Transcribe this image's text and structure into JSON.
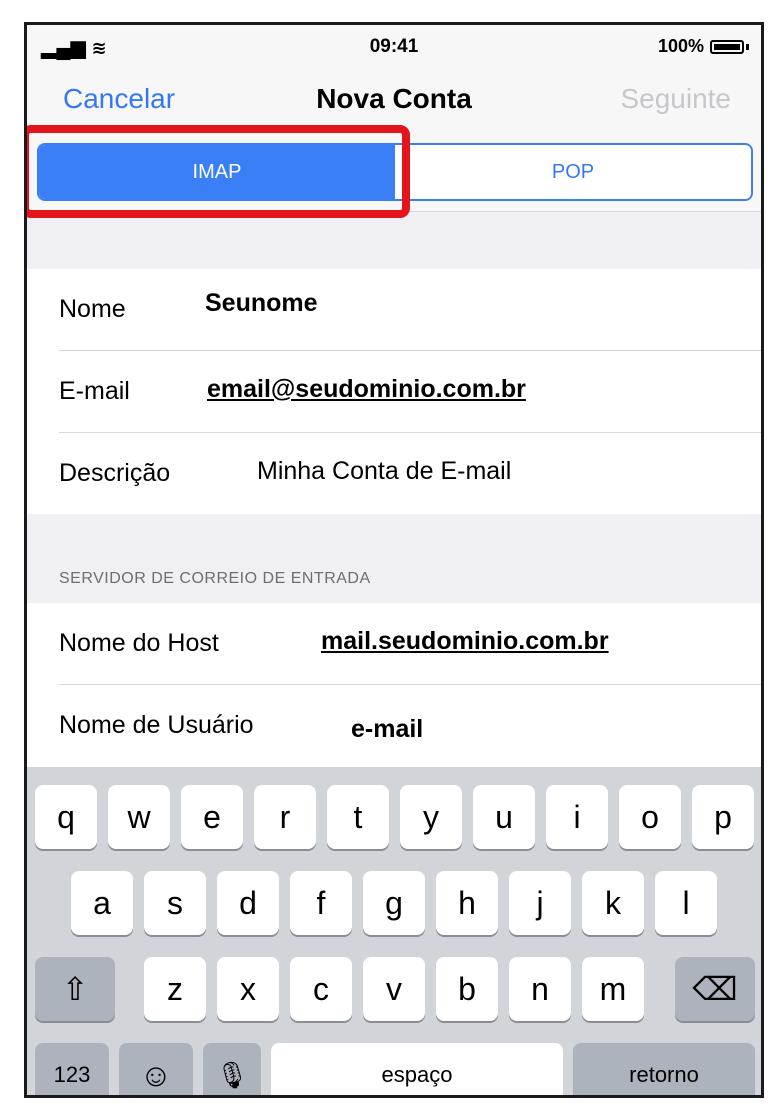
{
  "status_bar": {
    "signal": "▐▐ ↑",
    "time": "09:41",
    "battery": "100%"
  },
  "nav": {
    "cancel": "Cancelar",
    "title": "Nova Conta",
    "next": "Seguinte"
  },
  "segment": {
    "imap": "IMAP",
    "pop": "POP",
    "selected": "IMAP"
  },
  "account": {
    "name_label": "Nome",
    "name_value": "Seunome",
    "email_label": "E-mail",
    "email_value": "email@seudominio.com.br",
    "desc_label": "Descrição",
    "desc_value": "Minha Conta de E-mail"
  },
  "incoming": {
    "header": "SERVIDOR DE CORREIO DE ENTRADA",
    "host_label": "Nome do Host",
    "host_value": "mail.seudominio.com.br",
    "user_label": "Nome de Usuário",
    "user_value": "e-mail"
  },
  "keyboard": {
    "row1": [
      "q",
      "w",
      "e",
      "r",
      "t",
      "y",
      "u",
      "i",
      "o",
      "p"
    ],
    "row2": [
      "a",
      "s",
      "d",
      "f",
      "g",
      "h",
      "j",
      "k",
      "l"
    ],
    "row3": [
      "z",
      "x",
      "c",
      "v",
      "b",
      "n",
      "m"
    ],
    "shift": "⇧",
    "delete": "⌫",
    "numbers": "123",
    "emoji": "☺",
    "mic": "🎙",
    "space": "espaço",
    "return": "retorno"
  },
  "colors": {
    "accent": "#3478f6",
    "highlight": "#e3141b",
    "keyboard_bg": "#d1d4d9"
  }
}
